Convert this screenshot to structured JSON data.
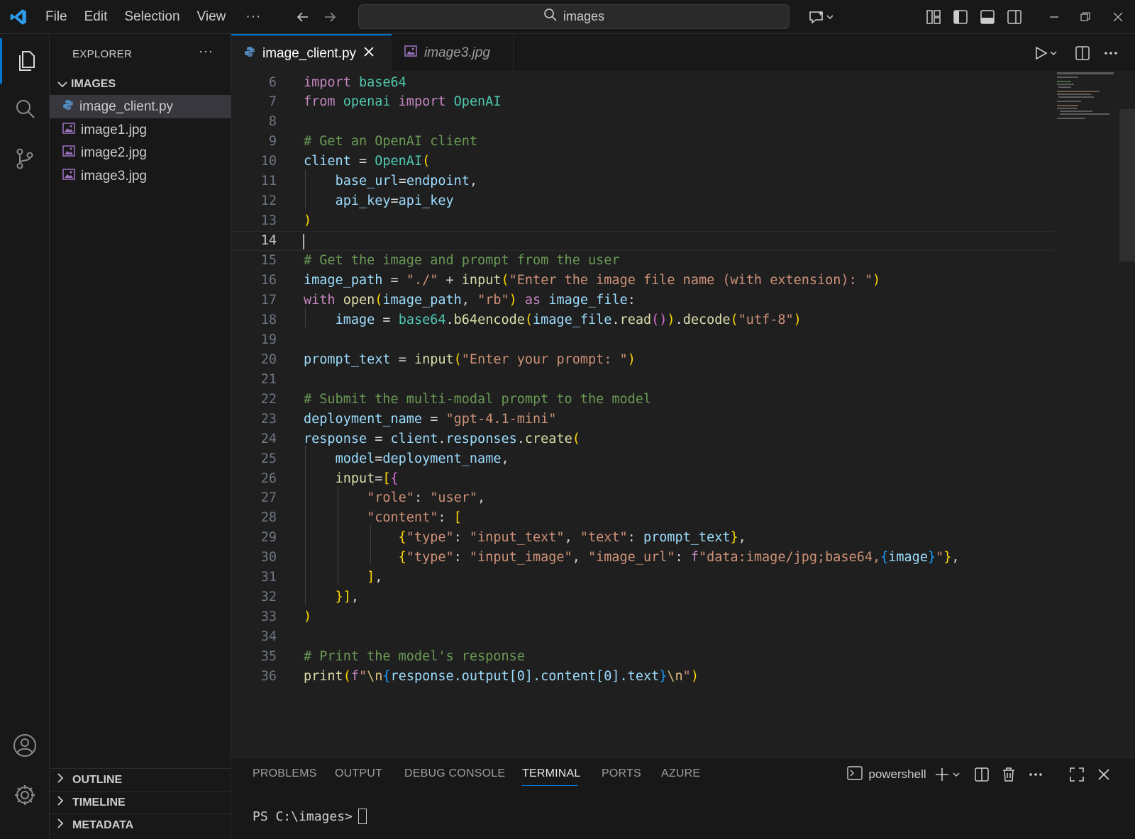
{
  "menu": {
    "file": "File",
    "edit": "Edit",
    "selection": "Selection",
    "view": "View",
    "more": "···"
  },
  "search": {
    "text": "images"
  },
  "sidebar": {
    "header": "EXPLORER",
    "more": "···",
    "folder": "IMAGES",
    "files": [
      {
        "name": "image_client.py",
        "icon": "python-file-icon",
        "selected": true
      },
      {
        "name": "image1.jpg",
        "icon": "image-file-icon"
      },
      {
        "name": "image2.jpg",
        "icon": "image-file-icon"
      },
      {
        "name": "image3.jpg",
        "icon": "image-file-icon"
      }
    ],
    "sections": [
      "OUTLINE",
      "TIMELINE",
      "METADATA"
    ]
  },
  "tabs": [
    {
      "label": "image_client.py",
      "active": true,
      "icon": "python-file-icon"
    },
    {
      "label": "image3.jpg",
      "active": false,
      "icon": "image-file-icon"
    }
  ],
  "editor": {
    "active_line": 14,
    "lines": [
      {
        "n": "6",
        "text": "import base64"
      },
      {
        "n": "7",
        "text": "from openai import OpenAI"
      },
      {
        "n": "8",
        "text": ""
      },
      {
        "n": "9",
        "text": "# Get an OpenAI client"
      },
      {
        "n": "10",
        "text": "client = OpenAI("
      },
      {
        "n": "11",
        "text": "    base_url=endpoint,"
      },
      {
        "n": "12",
        "text": "    api_key=api_key"
      },
      {
        "n": "13",
        "text": ")"
      },
      {
        "n": "14",
        "text": ""
      },
      {
        "n": "15",
        "text": "# Get the image and prompt from the user"
      },
      {
        "n": "16",
        "text": "image_path = \"./\" + input(\"Enter the image file name (with extension): \")"
      },
      {
        "n": "17",
        "text": "with open(image_path, \"rb\") as image_file:"
      },
      {
        "n": "18",
        "text": "    image = base64.b64encode(image_file.read()).decode(\"utf-8\")"
      },
      {
        "n": "19",
        "text": ""
      },
      {
        "n": "20",
        "text": "prompt_text = input(\"Enter your prompt: \")"
      },
      {
        "n": "21",
        "text": ""
      },
      {
        "n": "22",
        "text": "# Submit the multi-modal prompt to the model"
      },
      {
        "n": "23",
        "text": "deployment_name = \"gpt-4.1-mini\""
      },
      {
        "n": "24",
        "text": "response = client.responses.create("
      },
      {
        "n": "25",
        "text": "    model=deployment_name,"
      },
      {
        "n": "26",
        "text": "    input=[{"
      },
      {
        "n": "27",
        "text": "        \"role\": \"user\","
      },
      {
        "n": "28",
        "text": "        \"content\": ["
      },
      {
        "n": "29",
        "text": "            {\"type\": \"input_text\", \"text\": prompt_text},"
      },
      {
        "n": "30",
        "text": "            {\"type\": \"input_image\", \"image_url\": f\"data:image/jpg;base64,{image}\"},"
      },
      {
        "n": "31",
        "text": "        ],"
      },
      {
        "n": "32",
        "text": "    }],"
      },
      {
        "n": "33",
        "text": ")"
      },
      {
        "n": "34",
        "text": ""
      },
      {
        "n": "35",
        "text": "# Print the model's response"
      },
      {
        "n": "36",
        "text": "print(f\"\\n{response.output[0].content[0].text}\\n\")"
      }
    ]
  },
  "panel": {
    "tabs": [
      "PROBLEMS",
      "OUTPUT",
      "DEBUG CONSOLE",
      "TERMINAL",
      "PORTS",
      "AZURE"
    ],
    "active_tab": "TERMINAL",
    "shell": "powershell",
    "prompt": "PS C:\\images>"
  },
  "colors": {
    "accent": "#0078d4",
    "keyword": "#c586c0",
    "function": "#dcdcaa",
    "class": "#4ec9b0",
    "variable": "#9cdcfe",
    "string": "#ce9178",
    "comment": "#6a9955"
  }
}
